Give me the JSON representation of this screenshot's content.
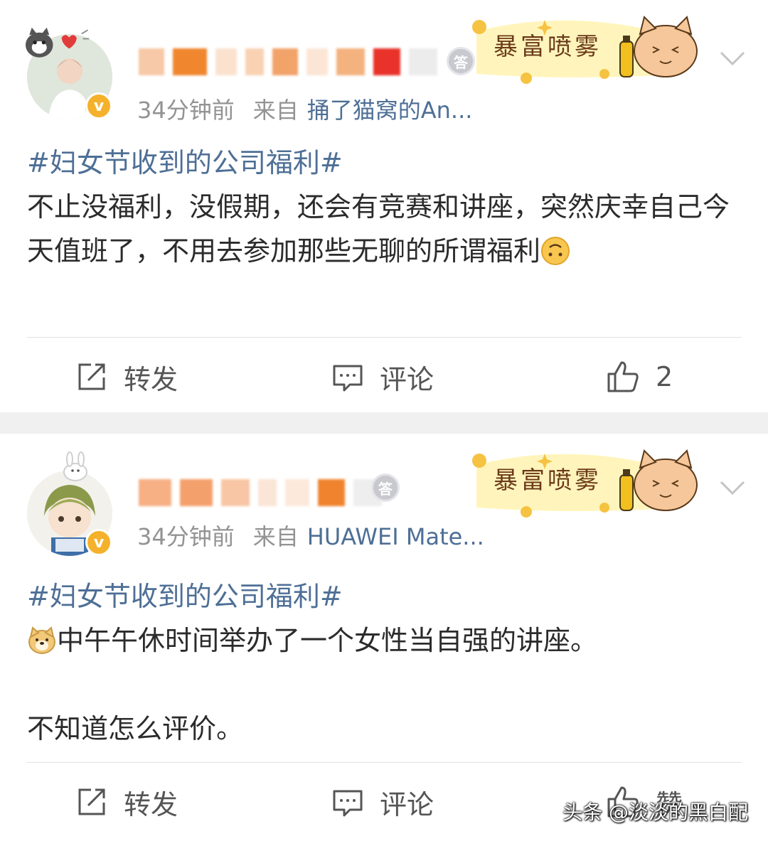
{
  "posts": [
    {
      "time": "34分钟前",
      "source_prefix": "来自",
      "source": "捅了猫窝的An...",
      "verify_badge": "v",
      "medal_text": "答",
      "promo_text": "暴富喷雾",
      "hashtag": "#妇女节收到的公司福利#",
      "lines": [
        "不止没福利，没假期，还会有竞赛和讲座，突然庆幸自己今天值班了，不用去参加那些无聊的所谓福利"
      ],
      "emoji": "upside-down-face",
      "actions": {
        "repost": "转发",
        "comment": "评论",
        "like": "2"
      }
    },
    {
      "time": "34分钟前",
      "source_prefix": "来自",
      "source": "HUAWEI Mate...",
      "verify_badge": "v",
      "medal_text": "答",
      "promo_text": "暴富喷雾",
      "hashtag": "#妇女节收到的公司福利#",
      "lines": [
        "中午午休时间举办了一个女性当自强的讲座。",
        "不知道怎么评价。"
      ],
      "emoji": "doge",
      "actions": {
        "repost": "转发",
        "comment": "评论",
        "like": "赞"
      }
    }
  ],
  "watermark": "头条 @淡淡的黑白配",
  "colors": {
    "link": "#4e6f96",
    "meta": "#939393",
    "badge": "#f5b12b",
    "background": "#f0f0f0"
  }
}
